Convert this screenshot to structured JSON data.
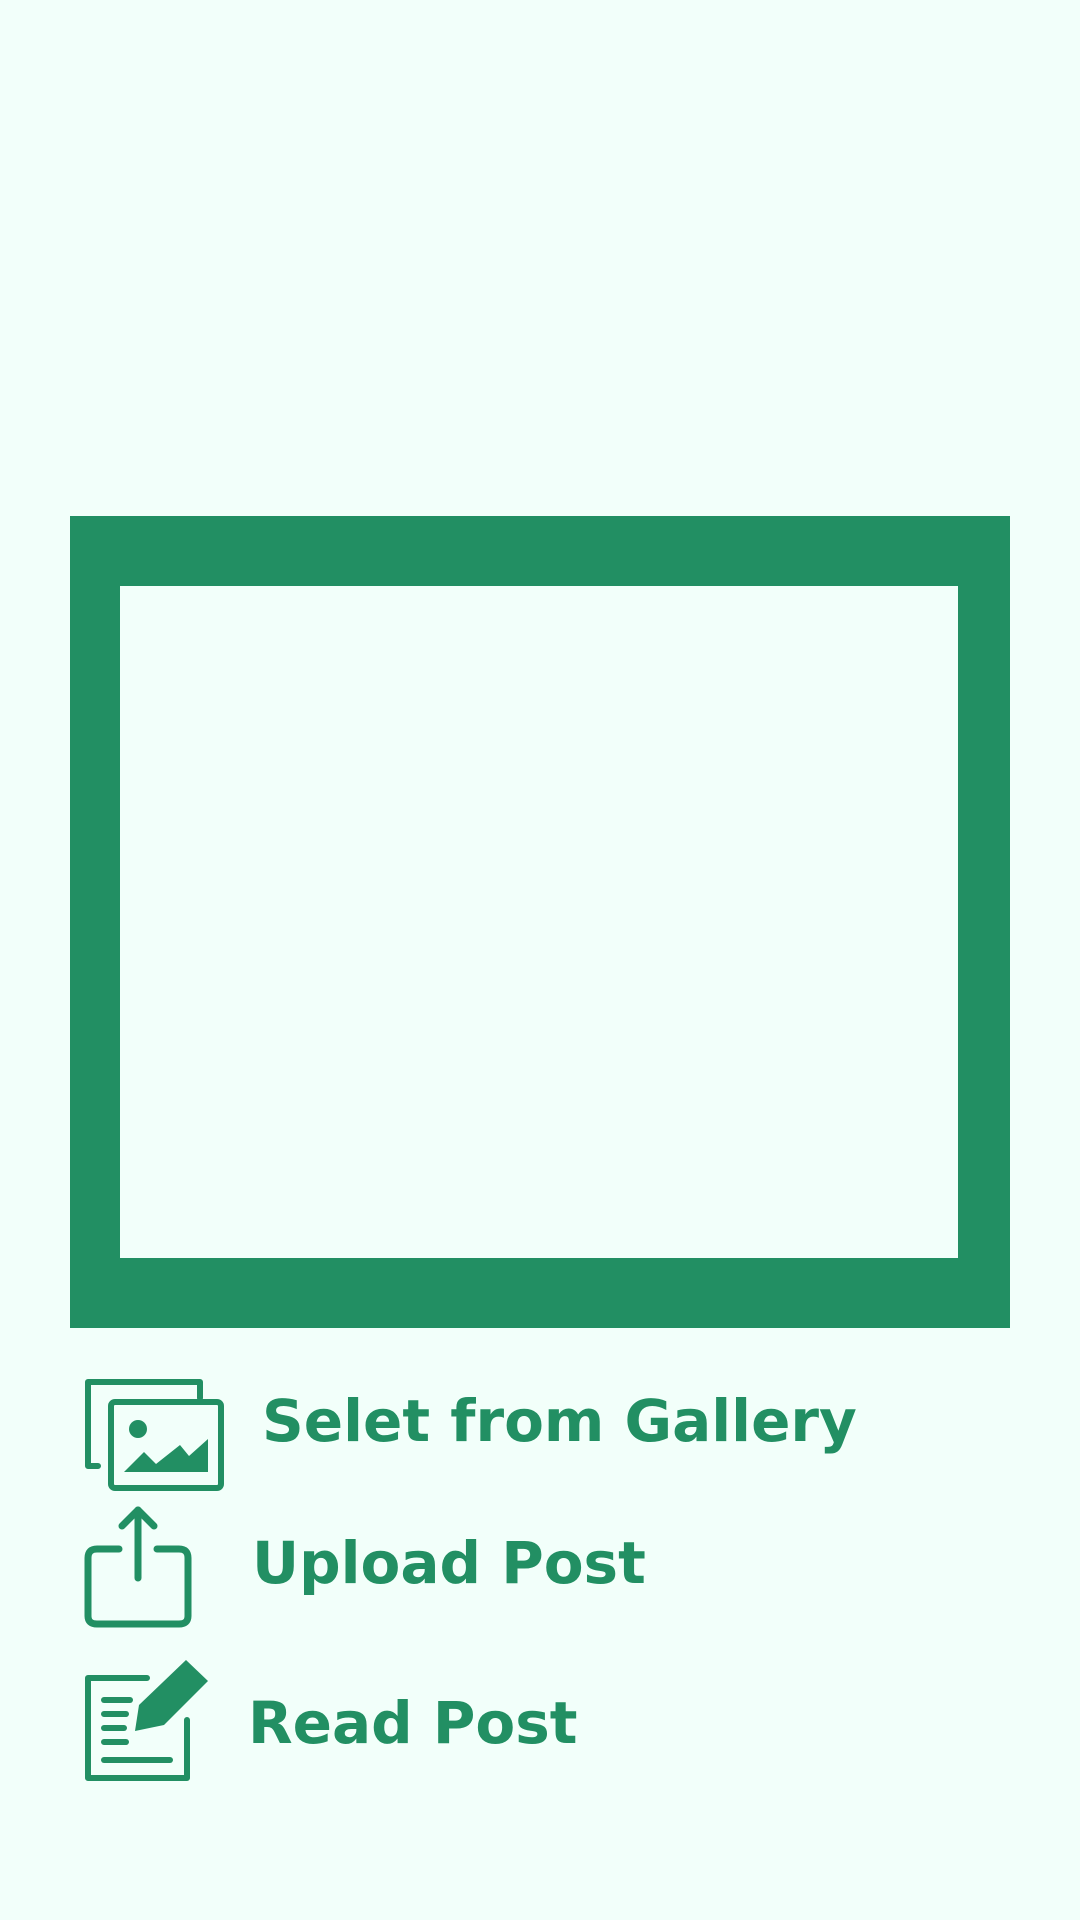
{
  "colors": {
    "background": "#f2fffa",
    "accent": "#228f63"
  },
  "preview": {
    "frame_icon": "image-preview-frame"
  },
  "actions": [
    {
      "id": "gallery",
      "icon": "gallery-icon",
      "label": "Selet from Gallery"
    },
    {
      "id": "upload",
      "icon": "upload-icon",
      "label": "Upload Post"
    },
    {
      "id": "read",
      "icon": "read-post-icon",
      "label": "Read Post"
    }
  ]
}
